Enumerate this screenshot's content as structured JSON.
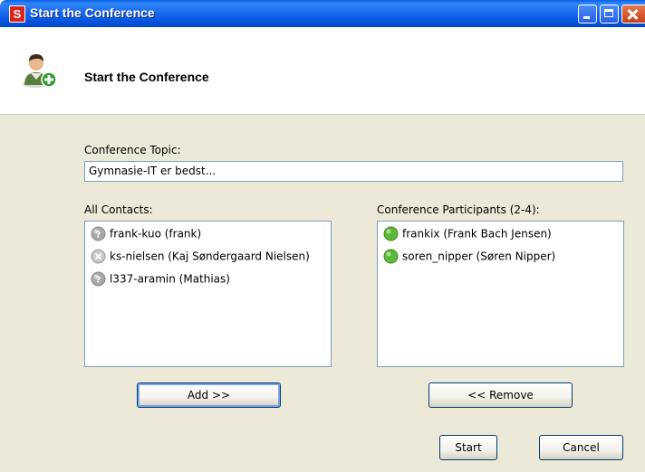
{
  "window": {
    "title": "Start the Conference",
    "app_icon_letter": "S"
  },
  "header": {
    "title": "Start the Conference",
    "icon": "user-add-icon"
  },
  "topic": {
    "label": "Conference Topic:",
    "value": "Gymnasie-IT er bedst..."
  },
  "contacts": {
    "label": "All Contacts:",
    "items": [
      {
        "name": "frank-kuo (frank)",
        "status": "unknown"
      },
      {
        "name": "ks-nielsen (Kaj Søndergaard Nielsen)",
        "status": "offline"
      },
      {
        "name": "l337-aramin (Mathias)",
        "status": "unknown"
      }
    ]
  },
  "participants": {
    "label": "Conference Participants (2-4):",
    "items": [
      {
        "name": "frankix (Frank Bach Jensen)",
        "status": "online"
      },
      {
        "name": "soren_nipper (Søren Nipper)",
        "status": "online"
      }
    ]
  },
  "buttons": {
    "add": "Add >>",
    "remove": "<< Remove",
    "start": "Start",
    "cancel": "Cancel"
  },
  "colors": {
    "titlebar": "#0653de",
    "body_bg": "#ece9d8",
    "online": "#5cb83a",
    "unknown": "#a8a8a8",
    "offline": "#c8c8c8"
  }
}
